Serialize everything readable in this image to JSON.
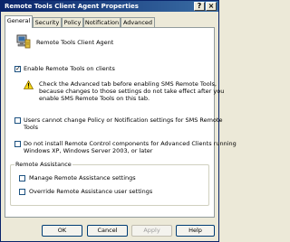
{
  "window": {
    "title": "Remote Tools Client Agent Properties"
  },
  "titlebar_buttons": {
    "help": "?",
    "close": "×"
  },
  "tabs": [
    "General",
    "Security",
    "Policy",
    "Notification",
    "Advanced"
  ],
  "general": {
    "heading": "Remote Tools Client Agent",
    "enable_label": "Enable Remote Tools on clients",
    "enable_checked": true,
    "warning_lines": [
      "Check the Advanced tab before enabling SMS Remote Tools,",
      "because changes to those settings do not take effect after you",
      "enable SMS Remote Tools on this tab."
    ],
    "users_cannot_change_lines": [
      "Users cannot change Policy or Notification settings for SMS Remote",
      "Tools"
    ],
    "users_cannot_change_checked": false,
    "do_not_install_lines": [
      "Do not install Remote Control components for Advanced Clients running",
      "Windows XP, Windows Server 2003, or later"
    ],
    "do_not_install_checked": false,
    "remote_assistance": {
      "title": "Remote Assistance",
      "manage_label": "Manage Remote Assistance settings",
      "manage_checked": false,
      "override_label": "Override Remote Assistance user settings",
      "override_checked": false
    }
  },
  "buttons": {
    "ok": "OK",
    "cancel": "Cancel",
    "apply": "Apply",
    "help": "Help"
  },
  "icons": {
    "agent": "agent-computer-icon",
    "warning": "warning-icon"
  }
}
